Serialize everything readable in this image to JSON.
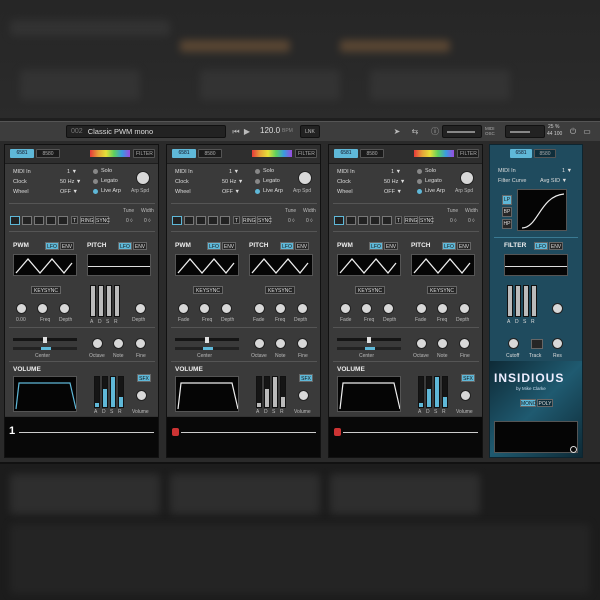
{
  "toolbar": {
    "preset_num": "002",
    "preset_name": "Classic PWM mono",
    "tempo": "120.0",
    "tempo_unit": "BPM",
    "link": "LNK",
    "zoom": "25 %",
    "sample_rate": "44 100",
    "mode_label": "MIDI OSC"
  },
  "common": {
    "tag1": "6581",
    "tag2": "8580",
    "filter": "FILTER",
    "midi_in": "MIDI In",
    "midi_in_val": "1 ▼",
    "clock": "Clock",
    "clock_val": "50 Hz ▼",
    "wheel": "Wheel",
    "wheel_val": "OFF ▼",
    "solo": "Solo",
    "legato": "Legato",
    "live_arp": "Live Arp",
    "arp_spd": "Arp Spd",
    "tune": "Tune",
    "width": "Width",
    "tune_val": "0 ◊",
    "width_val": "0 ◊",
    "ring": "RING",
    "sync": "SYNC",
    "t": "T",
    "pwm": "PWM",
    "pitch": "PITCH",
    "lfo": "LFO",
    "env": "ENV",
    "keysync": "KEYSYNC",
    "fade": "Fade",
    "freq": "Freq",
    "depth": "Depth",
    "adsr_a": "A",
    "adsr_d": "D",
    "adsr_s": "S",
    "adsr_r": "R",
    "center": "Center",
    "octave": "Octave",
    "note": "Note",
    "fine": "Fine",
    "volume": "VOLUME",
    "sfx": "SFX",
    "volume_knob": "Volume"
  },
  "voice1": {
    "fade_label": "0.00",
    "seq_label": "1"
  },
  "filter_dev": {
    "tag1": "6581",
    "tag2": "8580",
    "midi_in": "MIDI In",
    "midi_in_val": "1 ▼",
    "filter_curve": "Filter Curve",
    "curve_val": "Avg SID ▼",
    "lp": "LP",
    "bp": "BP",
    "hp": "HP",
    "filter": "FILTER",
    "lfo": "LFO",
    "env": "ENV",
    "a": "A",
    "d": "D",
    "s": "S",
    "r": "R",
    "cutoff": "Cutoff",
    "track": "Track",
    "res": "Res",
    "logo": "INSIDIOUS",
    "byline": "by Mike Clarke",
    "mono": "MONO",
    "poly": "POLY"
  }
}
